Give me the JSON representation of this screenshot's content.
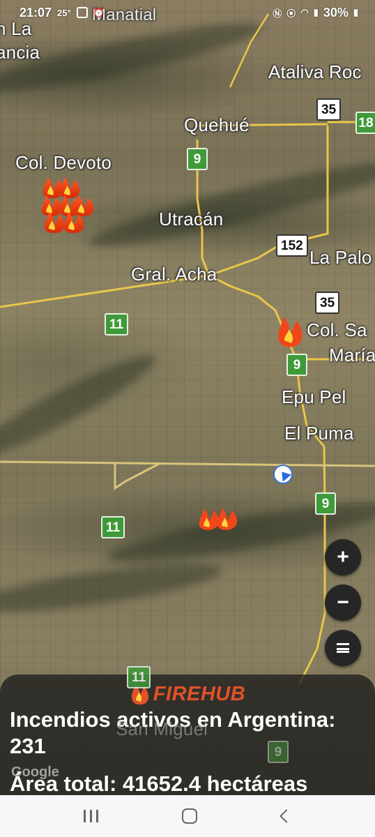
{
  "status_bar": {
    "time": "21:07",
    "temperature": "25°",
    "battery": "30%",
    "icons": [
      "image-icon",
      "alarm-icon",
      "nfc-icon",
      "location-icon",
      "wifi-icon",
      "signal-icon",
      "battery-icon"
    ]
  },
  "map": {
    "places": {
      "la_ancia_1": "n La",
      "la_ancia_2": "ancia",
      "manatial": "Manatial",
      "ataliva": "Ataliva Roc",
      "quehue": "Quehué",
      "col_devoto": "Col. Devoto",
      "utracan": "Utracán",
      "gral_acha": "Gral. Acha",
      "la_palo": "La Palo",
      "col_sa": "Col. Sa",
      "maria": "María",
      "epu_pel": "Epu Pel",
      "el_puma": "El Puma",
      "san_miguel": "San Miguel"
    },
    "shields": {
      "r35_top": "35",
      "r18": "18",
      "r9_quehue": "9",
      "r152": "152",
      "r35_mid": "35",
      "r11_left": "11",
      "r9_mid": "9",
      "r9_right": "9",
      "r11_bottom": "11",
      "r11_panel": "11",
      "r9_panel": "9"
    },
    "fire_icon": "fire-icon",
    "location_icon": "navigation-arrow-icon"
  },
  "controls": {
    "zoom_in": "+",
    "zoom_out": "−",
    "menu_icon": "menu-icon"
  },
  "info_panel": {
    "brand": "FIREHUB",
    "line1": "Incendios activos en Argentina:",
    "line2": "231",
    "area": "Área total: 41652.4 hectáreas",
    "google": "Google"
  },
  "colors": {
    "brand": "#e0522a",
    "route_shield": "#3f9a3a",
    "panel_bg": "#1c1c1c"
  }
}
